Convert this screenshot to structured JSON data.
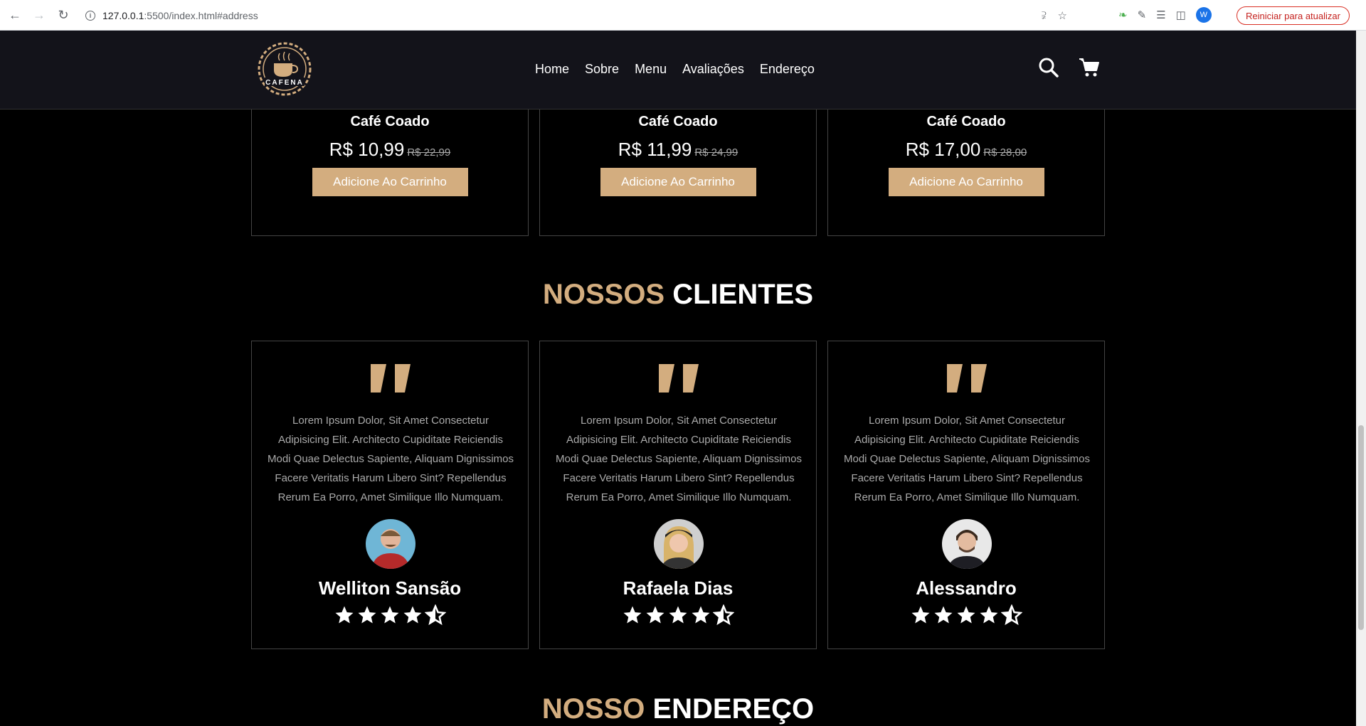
{
  "browser": {
    "url_host": "127.0.0.1",
    "url_rest": ":5500/index.html#address",
    "update_label": "Reiniciar para atualizar",
    "profile_initial": "W"
  },
  "header": {
    "logo_text": "CAFENA",
    "nav": [
      "Home",
      "Sobre",
      "Menu",
      "Avaliações",
      "Endereço"
    ]
  },
  "products": [
    {
      "name": "Café Coado",
      "price": "R$ 10,99",
      "old_price": "R$ 22,99",
      "button": "Adicione Ao Carrinho"
    },
    {
      "name": "Café Coado",
      "price": "R$ 11,99",
      "old_price": "R$ 24,99",
      "button": "Adicione Ao Carrinho"
    },
    {
      "name": "Café Coado",
      "price": "R$ 17,00",
      "old_price": "R$ 28,00",
      "button": "Adicione Ao Carrinho"
    }
  ],
  "reviews_section": {
    "title_accent": "NOSSOS",
    "title_rest": "CLIENTES"
  },
  "reviews": [
    {
      "text": "Lorem Ipsum Dolor, Sit Amet Consectetur Adipisicing Elit. Architecto Cupiditate Reiciendis Modi Quae Delectus Sapiente, Aliquam Dignissimos Facere Veritatis Harum Libero Sint? Repellendus Rerum Ea Porro, Amet Similique Illo Numquam.",
      "name": "Welliton Sansão",
      "rating": 4.5
    },
    {
      "text": "Lorem Ipsum Dolor, Sit Amet Consectetur Adipisicing Elit. Architecto Cupiditate Reiciendis Modi Quae Delectus Sapiente, Aliquam Dignissimos Facere Veritatis Harum Libero Sint? Repellendus Rerum Ea Porro, Amet Similique Illo Numquam.",
      "name": "Rafaela Dias",
      "rating": 4.5
    },
    {
      "text": "Lorem Ipsum Dolor, Sit Amet Consectetur Adipisicing Elit. Architecto Cupiditate Reiciendis Modi Quae Delectus Sapiente, Aliquam Dignissimos Facere Veritatis Harum Libero Sint? Repellendus Rerum Ea Porro, Amet Similique Illo Numquam.",
      "name": "Alessandro",
      "rating": 4.5
    }
  ],
  "address_section": {
    "title_accent": "NOSSO",
    "title_rest": "ENDEREÇO"
  },
  "colors": {
    "accent": "#d3ad7f",
    "header_bg": "#13131a",
    "page_bg": "#000000"
  }
}
